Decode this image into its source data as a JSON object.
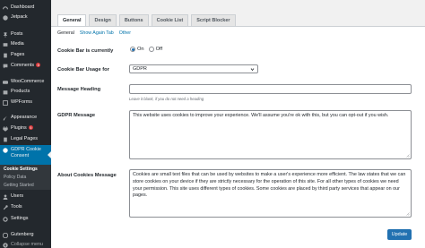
{
  "sidebar": {
    "items": [
      {
        "label": "Dashboard",
        "icon": "dashboard-icon"
      },
      {
        "label": "Jetpack",
        "icon": "jetpack-icon"
      },
      {
        "label": "Posts",
        "icon": "pin-icon"
      },
      {
        "label": "Media",
        "icon": "media-icon"
      },
      {
        "label": "Pages",
        "icon": "pages-icon"
      },
      {
        "label": "Comments",
        "icon": "comment-icon",
        "badge": "5"
      },
      {
        "label": "WooCommerce",
        "icon": "woocommerce-icon"
      },
      {
        "label": "Products",
        "icon": "products-icon"
      },
      {
        "label": "WPForms",
        "icon": "wpforms-icon"
      },
      {
        "label": "Appearance",
        "icon": "brush-icon"
      },
      {
        "label": "Plugins",
        "icon": "plugin-icon",
        "badge": "5"
      },
      {
        "label": "Legal Pages",
        "icon": "legal-pages-icon"
      },
      {
        "label": "GDPR Cookie Consent",
        "icon": "gdpr-icon"
      },
      {
        "label": "Users",
        "icon": "users-icon"
      },
      {
        "label": "Tools",
        "icon": "tools-icon"
      },
      {
        "label": "Settings",
        "icon": "settings-icon"
      },
      {
        "label": "Gutenberg",
        "icon": "gutenberg-icon"
      },
      {
        "label": "Collapse menu",
        "icon": "collapse-icon"
      }
    ],
    "submenu": [
      "Cookie Settings",
      "Policy Data",
      "Getting Started"
    ]
  },
  "tabs": [
    "General",
    "Design",
    "Buttons",
    "Cookie List",
    "Script Blocker"
  ],
  "subnav": [
    "General",
    "Show Again Tab",
    "Other"
  ],
  "form": {
    "cookie_bar_label": "Cookie Bar is currently",
    "radio_on": "On",
    "radio_off": "Off",
    "usage_label": "Cookie Bar Usage for",
    "usage_value": "GDPR",
    "heading_label": "Message Heading",
    "heading_value": "",
    "heading_hint": "Leave it blank, if you do not need a heading",
    "gdpr_message_label": "GDPR Message",
    "gdpr_message_value": "This website uses cookies to improve your experience. We'll assume you're ok with this, but you can opt-out if you wish.",
    "about_label": "About Cookies Message",
    "about_value": "Cookies are small text files that can be used by websites to make a user's experience more efficient. The law states that we can store cookies on your device if they are strictly necessary for the operation of this site. For all other types of cookies we need your permission. This site uses different types of cookies. Some cookies are placed by third party services that appear on our pages."
  },
  "update_button": "Update",
  "colors": {
    "sidebar": "#23282d",
    "active": "#0073aa",
    "button": "#2271b1",
    "badge": "#d63638"
  }
}
